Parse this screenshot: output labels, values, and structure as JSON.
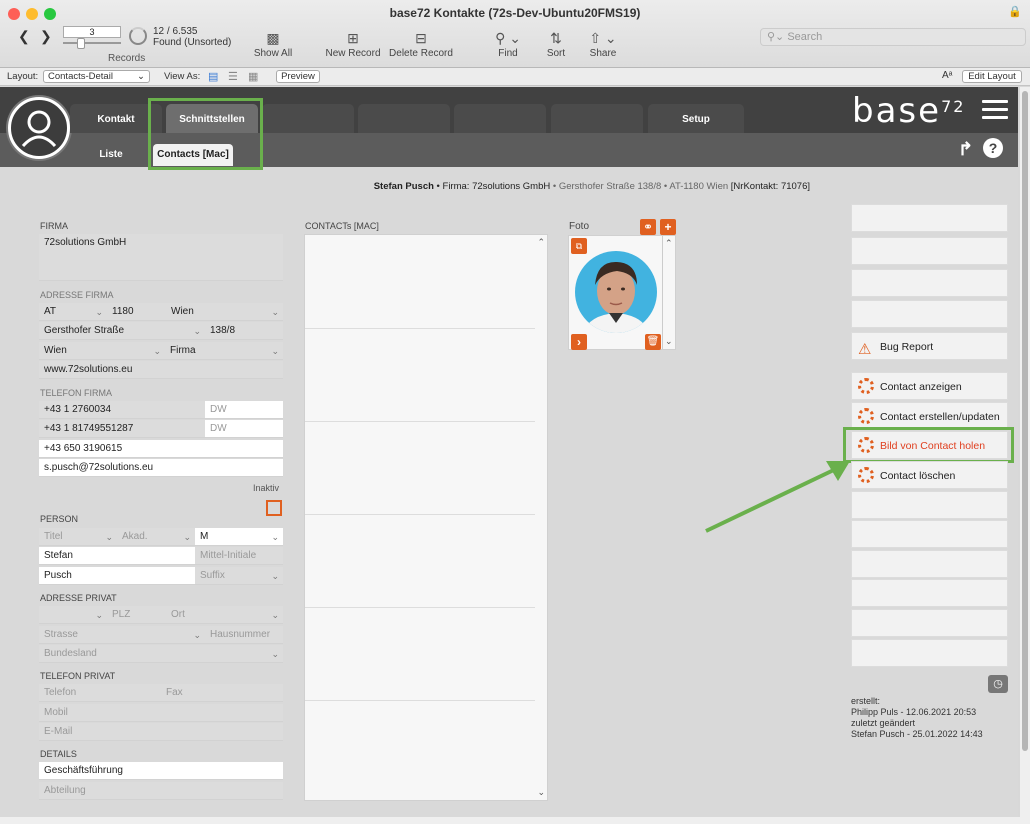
{
  "window": {
    "title": "base72 Kontakte (72s-Dev-Ubuntu20FMS19)"
  },
  "toolbar": {
    "record_number": "3",
    "found_count": "12 / 6.535",
    "found_status": "Found (Unsorted)",
    "records_label": "Records",
    "show_all": "Show All",
    "new_record": "New Record",
    "delete_record": "Delete Record",
    "find": "Find",
    "sort": "Sort",
    "share": "Share",
    "search_placeholder": "Search"
  },
  "layoutbar": {
    "layout_label": "Layout:",
    "layout_value": "Contacts-Detail",
    "view_as": "View As:",
    "preview": "Preview",
    "edit_layout": "Edit Layout"
  },
  "tabs": [
    "Kontakt",
    "Schnittstellen",
    "",
    "",
    "",
    "",
    "Setup"
  ],
  "subtabs": [
    "Liste",
    "Contacts [Mac]"
  ],
  "logo": "base",
  "logo_sup": "72",
  "infoline": {
    "name": "Stefan Pusch",
    "firma": " • Firma: 72solutions GmbH",
    "address": " • Gersthofer Straße 138/8 • AT-1180 Wien ",
    "nr": "[NrKontakt: 71076]"
  },
  "firma": {
    "label": "FIRMA",
    "name": "72solutions GmbH",
    "adresse_label": "ADRESSE  FIRMA",
    "country": "AT",
    "plz": "1180",
    "city": "Wien",
    "street": "Gersthofer Straße",
    "number": "138/8",
    "state": "Wien",
    "type": "Firma",
    "web": "www.72solutions.eu",
    "telefon_label": "TELEFON  FIRMA",
    "phone1": "+43 1 2760034",
    "phone2": "+43 1 81749551287",
    "dw": "DW",
    "mobile": "+43 650 3190615",
    "email": "s.pusch@72solutions.eu",
    "inaktiv": "Inaktiv"
  },
  "person": {
    "label": "PERSON",
    "titel": "Titel",
    "akad": "Akad.",
    "gender": "M",
    "first": "Stefan",
    "mittel": "Mittel-Initiale",
    "last": "Pusch",
    "suffix": "Suffix",
    "adresse_label": "ADRESSE  PRIVAT",
    "plz": "PLZ",
    "ort": "Ort",
    "strasse": "Strasse",
    "hausnummer": "Hausnummer",
    "bundesland": "Bundesland",
    "telefon_label": "TELEFON  PRIVAT",
    "telefon": "Telefon",
    "fax": "Fax",
    "mobil": "Mobil",
    "email": "E-Mail",
    "details_label": "DETAILS",
    "position": "Geschäftsführung",
    "abteilung": "Abteilung"
  },
  "contacts_panel": {
    "label": "CONTACTs [MAC]"
  },
  "foto": {
    "label": "Foto"
  },
  "actions": {
    "bug_report": "Bug Report",
    "show": "Contact anzeigen",
    "create": "Contact erstellen/updaten",
    "fetch_image": "Bild von Contact holen",
    "delete": "Contact löschen"
  },
  "audit": {
    "created_label": "erstellt:",
    "created": "Philipp Puls - 12.06.2021 20:53",
    "changed_label": "zuletzt geändert",
    "changed": "Stefan Pusch - 25.01.2022 14:43"
  },
  "colors": {
    "accent": "#e06020",
    "highlight": "#6ab04c",
    "header": "#414141"
  }
}
